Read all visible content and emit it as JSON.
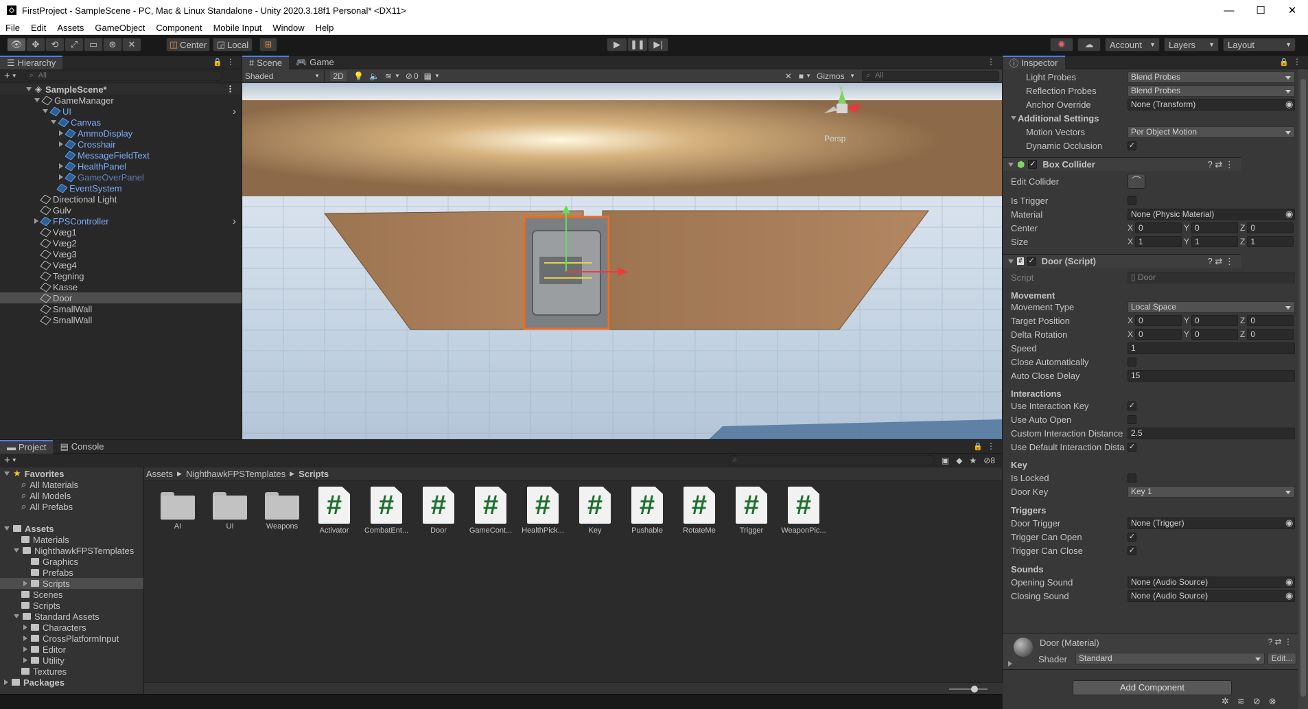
{
  "window": {
    "title": "FirstProject - SampleScene - PC, Mac & Linux Standalone - Unity 2020.3.18f1 Personal* <DX11>",
    "minimize": "—",
    "maximize": "☐",
    "close": "✕"
  },
  "menu": [
    "File",
    "Edit",
    "Assets",
    "GameObject",
    "Component",
    "Mobile Input",
    "Window",
    "Help"
  ],
  "toolbar": {
    "center": "Center",
    "local": "Local",
    "account": "Account",
    "layers": "Layers",
    "layout": "Layout"
  },
  "hierarchy": {
    "tab": "Hierarchy",
    "search": "All",
    "scene": "SampleScene*",
    "items": [
      {
        "label": "GameManager",
        "indent": 1,
        "type": "normal",
        "arrow": "down"
      },
      {
        "label": "UI",
        "indent": 2,
        "type": "prefab",
        "arrow": "down",
        "chev": true
      },
      {
        "label": "Canvas",
        "indent": 3,
        "type": "prefab",
        "arrow": "down"
      },
      {
        "label": "AmmoDisplay",
        "indent": 4,
        "type": "prefab",
        "arrow": "right"
      },
      {
        "label": "Crosshair",
        "indent": 4,
        "type": "prefab",
        "arrow": "right"
      },
      {
        "label": "MessageFieldText",
        "indent": 4,
        "type": "prefab",
        "arrow": ""
      },
      {
        "label": "HealthPanel",
        "indent": 4,
        "type": "prefab",
        "arrow": "right"
      },
      {
        "label": "GameOverPanel",
        "indent": 4,
        "type": "dim",
        "arrow": "right"
      },
      {
        "label": "EventSystem",
        "indent": 3,
        "type": "prefab",
        "arrow": ""
      },
      {
        "label": "Directional Light",
        "indent": 1,
        "type": "normal",
        "arrow": ""
      },
      {
        "label": "Gulv",
        "indent": 1,
        "type": "normal",
        "arrow": ""
      },
      {
        "label": "FPSController",
        "indent": 1,
        "type": "prefab",
        "arrow": "right",
        "chev": true
      },
      {
        "label": "Væg1",
        "indent": 1,
        "type": "normal",
        "arrow": ""
      },
      {
        "label": "Væg2",
        "indent": 1,
        "type": "normal",
        "arrow": ""
      },
      {
        "label": "Væg3",
        "indent": 1,
        "type": "normal",
        "arrow": ""
      },
      {
        "label": "Væg4",
        "indent": 1,
        "type": "normal",
        "arrow": ""
      },
      {
        "label": "Tegning",
        "indent": 1,
        "type": "normal",
        "arrow": ""
      },
      {
        "label": "Kasse",
        "indent": 1,
        "type": "normal",
        "arrow": ""
      },
      {
        "label": "Door",
        "indent": 1,
        "type": "normal",
        "arrow": "",
        "sel": true
      },
      {
        "label": "SmallWall",
        "indent": 1,
        "type": "normal",
        "arrow": ""
      },
      {
        "label": "SmallWall",
        "indent": 1,
        "type": "normal",
        "arrow": ""
      }
    ]
  },
  "scene": {
    "tab_scene": "Scene",
    "tab_game": "Game",
    "shading": "Shaded",
    "mode2d": "2D",
    "hidden_count": "0",
    "gizmos": "Gizmos",
    "search": "All",
    "persp": "Persp"
  },
  "project": {
    "tab_project": "Project",
    "tab_console": "Console",
    "hidden_count": "8",
    "breadcrumb": [
      "Assets",
      "NighthawkFPSTemplates",
      "Scripts"
    ],
    "tree": [
      {
        "label": "Favorites",
        "indent": 0,
        "kind": "fav",
        "arrow": "down",
        "bold": true
      },
      {
        "label": "All Materials",
        "indent": 1,
        "kind": "search"
      },
      {
        "label": "All Models",
        "indent": 1,
        "kind": "search"
      },
      {
        "label": "All Prefabs",
        "indent": 1,
        "kind": "search"
      },
      {
        "label": "",
        "indent": 0,
        "kind": "gap"
      },
      {
        "label": "Assets",
        "indent": 0,
        "kind": "folder",
        "arrow": "down",
        "bold": true
      },
      {
        "label": "Materials",
        "indent": 1,
        "kind": "folder"
      },
      {
        "label": "NighthawkFPSTemplates",
        "indent": 1,
        "kind": "folder",
        "arrow": "down"
      },
      {
        "label": "Graphics",
        "indent": 2,
        "kind": "folder"
      },
      {
        "label": "Prefabs",
        "indent": 2,
        "kind": "folder"
      },
      {
        "label": "Scripts",
        "indent": 2,
        "kind": "folder",
        "arrow": "right",
        "sel": true
      },
      {
        "label": "Scenes",
        "indent": 1,
        "kind": "folder"
      },
      {
        "label": "Scripts",
        "indent": 1,
        "kind": "folder"
      },
      {
        "label": "Standard Assets",
        "indent": 1,
        "kind": "folder",
        "arrow": "down"
      },
      {
        "label": "Characters",
        "indent": 2,
        "kind": "folder",
        "arrow": "right"
      },
      {
        "label": "CrossPlatformInput",
        "indent": 2,
        "kind": "folder",
        "arrow": "right"
      },
      {
        "label": "Editor",
        "indent": 2,
        "kind": "folder",
        "arrow": "right"
      },
      {
        "label": "Utility",
        "indent": 2,
        "kind": "folder",
        "arrow": "right"
      },
      {
        "label": "Textures",
        "indent": 1,
        "kind": "folder"
      },
      {
        "label": "Packages",
        "indent": 0,
        "kind": "folder",
        "arrow": "right",
        "bold": true
      }
    ],
    "items": [
      {
        "label": "AI",
        "kind": "folder"
      },
      {
        "label": "UI",
        "kind": "folder"
      },
      {
        "label": "Weapons",
        "kind": "folder"
      },
      {
        "label": "Activator",
        "kind": "script"
      },
      {
        "label": "CombatEnt...",
        "kind": "script"
      },
      {
        "label": "Door",
        "kind": "script"
      },
      {
        "label": "GameCont...",
        "kind": "script"
      },
      {
        "label": "HealthPick...",
        "kind": "script"
      },
      {
        "label": "Key",
        "kind": "script"
      },
      {
        "label": "Pushable",
        "kind": "script"
      },
      {
        "label": "RotateMe",
        "kind": "script"
      },
      {
        "label": "Trigger",
        "kind": "script"
      },
      {
        "label": "WeaponPic...",
        "kind": "script"
      }
    ]
  },
  "inspector": {
    "tab": "Inspector",
    "light_probes_label": "Light Probes",
    "light_probes": "Blend Probes",
    "reflection_probes_label": "Reflection Probes",
    "reflection_probes": "Blend Probes",
    "anchor_override_label": "Anchor Override",
    "anchor_override": "None (Transform)",
    "additional_settings": "Additional Settings",
    "motion_vectors_label": "Motion Vectors",
    "motion_vectors": "Per Object Motion",
    "dynamic_occlusion_label": "Dynamic Occlusion",
    "box_collider": "Box Collider",
    "edit_collider": "Edit Collider",
    "is_trigger": "Is Trigger",
    "material_label": "Material",
    "material": "None (Physic Material)",
    "center_label": "Center",
    "center": [
      "0",
      "0",
      "0"
    ],
    "size_label": "Size",
    "size": [
      "1",
      "1",
      "1"
    ],
    "door_script": "Door (Script)",
    "script_label": "Script",
    "script": "Door",
    "movement": "Movement",
    "movement_type_label": "Movement Type",
    "movement_type": "Local Space",
    "target_position_label": "Target Position",
    "target_position": [
      "0",
      "0",
      "0"
    ],
    "delta_rotation_label": "Delta Rotation",
    "delta_rotation": [
      "0",
      "0",
      "0"
    ],
    "speed_label": "Speed",
    "speed": "1",
    "close_auto_label": "Close Automatically",
    "auto_close_delay_label": "Auto Close Delay",
    "auto_close_delay": "15",
    "interactions": "Interactions",
    "use_interaction_key": "Use Interaction Key",
    "use_auto_open": "Use Auto Open",
    "custom_dist_label": "Custom Interaction Distance",
    "custom_dist": "2.5",
    "use_default_dist": "Use Default Interaction Dista",
    "key": "Key",
    "is_locked": "Is Locked",
    "door_key_label": "Door Key",
    "door_key": "Key 1",
    "triggers": "Triggers",
    "door_trigger_label": "Door Trigger",
    "door_trigger": "None (Trigger)",
    "trigger_can_open": "Trigger Can Open",
    "trigger_can_close": "Trigger Can Close",
    "sounds": "Sounds",
    "opening_sound_label": "Opening Sound",
    "opening_sound": "None (Audio Source)",
    "closing_sound_label": "Closing Sound",
    "closing_sound": "None (Audio Source)",
    "material_comp": "Door (Material)",
    "shader_label": "Shader",
    "shader": "Standard",
    "edit": "Edit...",
    "add_component": "Add Component",
    "x": "X",
    "y": "Y",
    "z": "Z"
  }
}
